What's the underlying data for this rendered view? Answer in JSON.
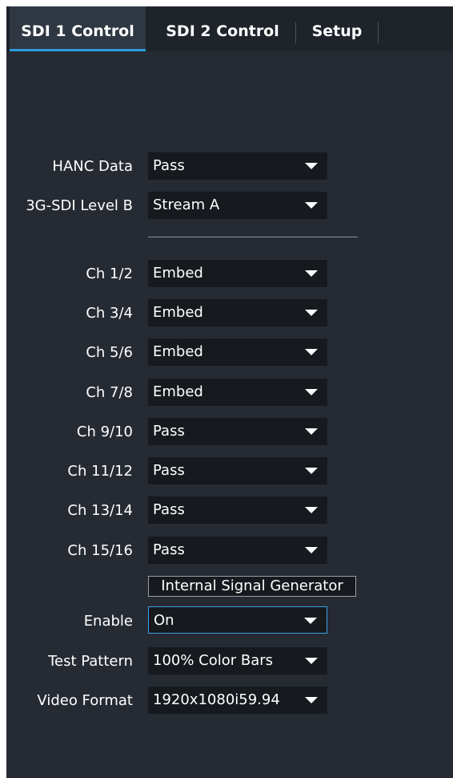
{
  "tabs": [
    {
      "label": "SDI 1 Control",
      "active": true
    },
    {
      "label": "SDI 2 Control",
      "active": false
    },
    {
      "label": "Setup",
      "active": false
    }
  ],
  "hanc": {
    "label": "HANC Data",
    "value": "Pass"
  },
  "level_b": {
    "label": "3G-SDI Level B",
    "value": "Stream A"
  },
  "channels": [
    {
      "label": "Ch 1/2",
      "value": "Embed"
    },
    {
      "label": "Ch 3/4",
      "value": "Embed"
    },
    {
      "label": "Ch 5/6",
      "value": "Embed"
    },
    {
      "label": "Ch 7/8",
      "value": "Embed"
    },
    {
      "label": "Ch 9/10",
      "value": "Pass"
    },
    {
      "label": "Ch 11/12",
      "value": "Pass"
    },
    {
      "label": "Ch 13/14",
      "value": "Pass"
    },
    {
      "label": "Ch 15/16",
      "value": "Pass"
    }
  ],
  "signal_generator": {
    "title": "Internal Signal Generator",
    "enable": {
      "label": "Enable",
      "value": "On"
    },
    "test_pattern": {
      "label": "Test Pattern",
      "value": "100% Color Bars"
    },
    "video_format": {
      "label": "Video Format",
      "value": "1920x1080i59.94"
    }
  },
  "colors": {
    "panel_bg": "#262b33",
    "accent": "#2a9de0",
    "dropdown_bg": "#16191e"
  }
}
